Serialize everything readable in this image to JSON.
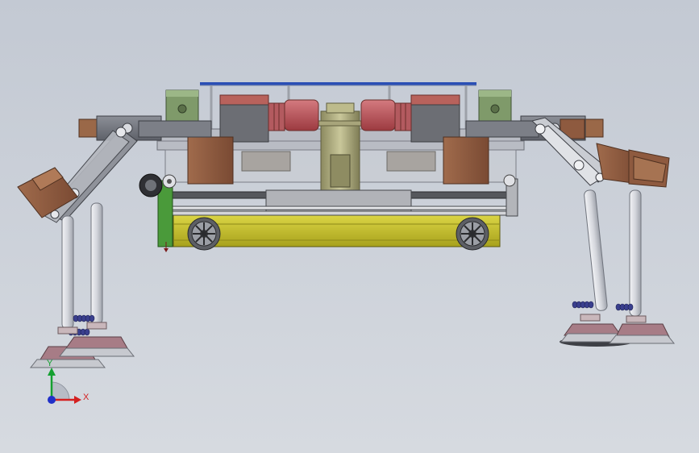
{
  "triad": {
    "x_label": "X",
    "y_label": "Y"
  },
  "colors": {
    "background": "#c9ced6",
    "chassis_yellow": "#c9c22b",
    "motor_red": "#c0555a",
    "block_brown": "#8e5a3f",
    "plate_blue": "#2a4fb5",
    "leg_metal": "#d8d9de",
    "suction_pad": "#a77c86"
  }
}
